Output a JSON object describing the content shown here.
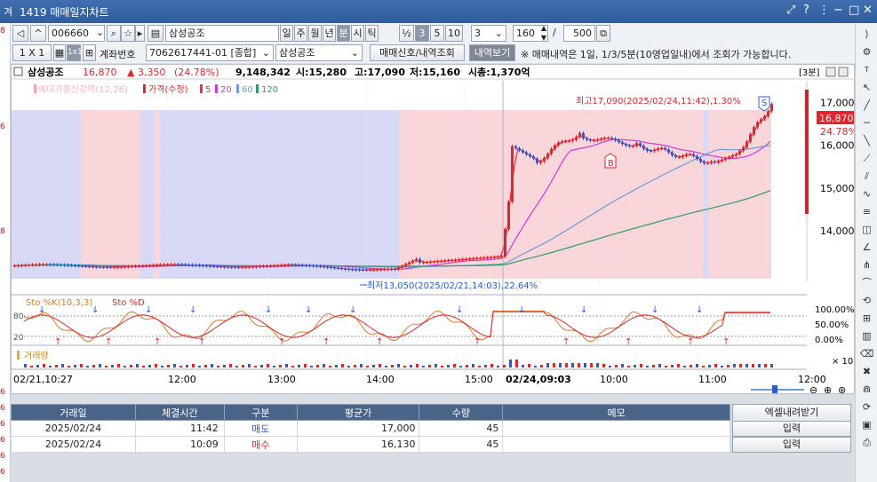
{
  "window": {
    "app_icon": "겨",
    "title": "1419 매매일지차트"
  },
  "left_strip": [
    "8",
    "6",
    "8",
    "6",
    "6",
    "6",
    "6",
    "6",
    "6"
  ],
  "toolbar1": {
    "code": "006660",
    "name": "삼성공조",
    "periods": [
      "일",
      "주",
      "월",
      "년",
      "분",
      "시",
      "틱"
    ],
    "active_period": "분",
    "frac": "½",
    "minutes": [
      "3",
      "5",
      "10"
    ],
    "active_minute": "3",
    "interval_value": "3",
    "count_value": "160",
    "slash": "/",
    "total_value": "500"
  },
  "toolbar2": {
    "scale": "1 X 1",
    "grid1": "1x1",
    "account_label": "계좌번호",
    "account_value": "7062617441-01 [종합]",
    "stock_value": "삼성공조",
    "btn_signals": "매매신호/내역조회",
    "btn_history": "내역보기",
    "notice": "※ 매매내역은 1일, 1/3/5분(10영업일내)에서 조회가 가능합니다."
  },
  "quote": {
    "name": "삼성공조",
    "price": "16,870",
    "change": "▲ 3,350",
    "change_rate": "(24.78%)",
    "volume": "9,148,342",
    "open": "시:15,280",
    "high": "고:17,090",
    "low": "저:15,160",
    "mcap": "시총:1,370억",
    "period_tag": "[3분]"
  },
  "legend": {
    "bg_label": "예대가중신강력(12,26)",
    "price_label": "가격(수정)",
    "ma": [
      "5",
      "20",
      "60",
      "120"
    ]
  },
  "annotations": {
    "high": "최고17,090(2025/02/24,11:42),1.30%",
    "low": "최저13,050(2025/02/21,14:03),22.64%",
    "sell_marker": "S",
    "buy_marker": "B",
    "price_tag": "16,870",
    "rate_tag": "24.78%"
  },
  "price_axis": [
    "17,000",
    "16,000",
    "15,000",
    "14,000"
  ],
  "stochastic": {
    "label_k": "Sto %K(10,3,3)",
    "label_d": "Sto %D",
    "levels": [
      "80",
      "20"
    ],
    "axis": [
      "100.00%",
      "50.00%",
      "0.00%"
    ]
  },
  "volume": {
    "label": "거래량",
    "axis": "× 10"
  },
  "x_axis": [
    "02/21,10:27",
    "12:00",
    "13:00",
    "14:00",
    "15:00",
    "02/24,09:03",
    "10:00",
    "11:00",
    "12:00"
  ],
  "colors": {
    "up": "#e0262b",
    "down": "#2a59d6",
    "ma5": "#e9323b",
    "ma20": "#cf3bd9",
    "ma60": "#6e9ad8",
    "ma120": "#2e9c63",
    "bg_pink": "#f9d6d9",
    "bg_blue": "#d8d9f7"
  },
  "table": {
    "headers": [
      "거래일",
      "체결시간",
      "구분",
      "평균가",
      "수량",
      "메모"
    ],
    "rows": [
      [
        "2025/02/24",
        "11:42",
        "매도",
        "17,000",
        "45",
        ""
      ],
      [
        "2025/02/24",
        "10:09",
        "매수",
        "16,130",
        "45",
        ""
      ]
    ],
    "excel_button": "엑셀내려받기",
    "input_buttons": [
      "입력",
      "입력"
    ]
  },
  "chart_data": {
    "type": "candlestick",
    "price_axis_range": [
      12900,
      17300
    ],
    "price_ticks": [
      14000,
      15000,
      16000,
      17000
    ],
    "sessions": [
      {
        "date": "2025/02/21",
        "start": "10:27",
        "end": "15:30"
      },
      {
        "date": "2025/02/24",
        "start": "09:03",
        "end": "11:57"
      }
    ],
    "high": {
      "value": 17090,
      "time": "2025/02/24 11:42"
    },
    "low": {
      "value": 13050,
      "time": "2025/02/21 14:03"
    },
    "last": 16870,
    "trades": [
      {
        "side": "buy",
        "time": "2025/02/24 10:09",
        "price": 16130
      },
      {
        "side": "sell",
        "time": "2025/02/24 11:42",
        "price": 17000
      }
    ]
  }
}
